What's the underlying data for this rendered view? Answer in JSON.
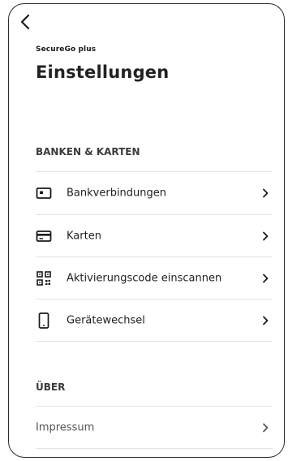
{
  "header": {
    "back_icon": "chevron-left-icon",
    "app_name": "SecureGo plus",
    "title": "Einstellungen"
  },
  "sections": [
    {
      "heading": "BANKEN & KARTEN",
      "items": [
        {
          "label": "Bankverbindungen",
          "icon": "bank-account-icon"
        },
        {
          "label": "Karten",
          "icon": "credit-card-icon"
        },
        {
          "label": "Aktivierungscode einscannen",
          "icon": "qr-code-icon"
        },
        {
          "label": "Gerätewechsel",
          "icon": "smartphone-icon"
        }
      ]
    },
    {
      "heading": "ÜBER",
      "items": [
        {
          "label": "Impressum"
        }
      ]
    }
  ]
}
